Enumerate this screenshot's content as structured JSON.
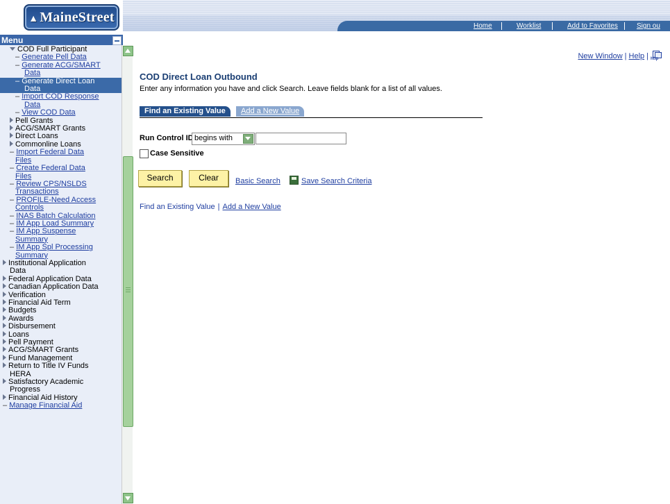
{
  "logo": {
    "text": "MaineStreet"
  },
  "nav": {
    "home": "Home",
    "worklist": "Worklist",
    "favorites": "Add to Favorites",
    "signout": "Sign ou"
  },
  "menu": {
    "title": "Menu",
    "items": [
      {
        "label": "COD Full Participant",
        "type": "folder-open",
        "indent": 1
      },
      {
        "label": "Generate Pell Data",
        "type": "link",
        "indent": 2
      },
      {
        "label": "Generate ACG/SMART",
        "type": "link",
        "indent": 2
      },
      {
        "label": "Data",
        "type": "link-cont",
        "indent": 3
      },
      {
        "label": "Generate Direct Loan",
        "type": "link",
        "indent": 2,
        "selected": true
      },
      {
        "label": "Data",
        "type": "link-cont",
        "indent": 3,
        "selected": true
      },
      {
        "label": "Import COD Response",
        "type": "link",
        "indent": 2
      },
      {
        "label": "Data",
        "type": "link-cont",
        "indent": 3
      },
      {
        "label": "View COD Data",
        "type": "link",
        "indent": 2
      },
      {
        "label": "Pell Grants",
        "type": "folder",
        "indent": 1
      },
      {
        "label": "ACG/SMART Grants",
        "type": "folder",
        "indent": 1
      },
      {
        "label": "Direct Loans",
        "type": "folder",
        "indent": 1
      },
      {
        "label": "Commonline Loans",
        "type": "folder",
        "indent": 1
      },
      {
        "label": "Import Federal Data",
        "type": "link",
        "indent": 1
      },
      {
        "label": "Files",
        "type": "link-cont",
        "indent": 2
      },
      {
        "label": "Create Federal Data",
        "type": "link",
        "indent": 1
      },
      {
        "label": "Files",
        "type": "link-cont",
        "indent": 2
      },
      {
        "label": "Review CPS/NSLDS",
        "type": "link",
        "indent": 1
      },
      {
        "label": "Transactions",
        "type": "link-cont",
        "indent": 2
      },
      {
        "label": "PROFILE-Need Access",
        "type": "link",
        "indent": 1
      },
      {
        "label": "Controls",
        "type": "link-cont",
        "indent": 2
      },
      {
        "label": "INAS Batch Calculation",
        "type": "link",
        "indent": 1
      },
      {
        "label": "IM App Load Summary",
        "type": "link",
        "indent": 1
      },
      {
        "label": "IM App Suspense",
        "type": "link",
        "indent": 1
      },
      {
        "label": "Summary",
        "type": "link-cont",
        "indent": 2
      },
      {
        "label": "IM App Spl Processing",
        "type": "link",
        "indent": 1
      },
      {
        "label": "Summary",
        "type": "link-cont",
        "indent": 2
      },
      {
        "label": "Institutional Application",
        "type": "folder",
        "indent": 0
      },
      {
        "label": "Data",
        "type": "text-cont",
        "indent": 1
      },
      {
        "label": "Federal Application Data",
        "type": "folder",
        "indent": 0
      },
      {
        "label": "Canadian Application Data",
        "type": "folder",
        "indent": 0
      },
      {
        "label": "Verification",
        "type": "folder",
        "indent": 0
      },
      {
        "label": "Financial Aid Term",
        "type": "folder",
        "indent": 0
      },
      {
        "label": "Budgets",
        "type": "folder",
        "indent": 0
      },
      {
        "label": "Awards",
        "type": "folder",
        "indent": 0
      },
      {
        "label": "Disbursement",
        "type": "folder",
        "indent": 0
      },
      {
        "label": "Loans",
        "type": "folder",
        "indent": 0
      },
      {
        "label": "Pell Payment",
        "type": "folder",
        "indent": 0
      },
      {
        "label": "ACG/SMART Grants",
        "type": "folder",
        "indent": 0
      },
      {
        "label": "Fund Management",
        "type": "folder",
        "indent": 0
      },
      {
        "label": "Return to Title IV Funds",
        "type": "folder",
        "indent": 0
      },
      {
        "label": "HERA",
        "type": "text-cont",
        "indent": 1
      },
      {
        "label": "Satisfactory Academic",
        "type": "folder",
        "indent": 0
      },
      {
        "label": "Progress",
        "type": "text-cont",
        "indent": 1
      },
      {
        "label": "Financial Aid History",
        "type": "folder",
        "indent": 0
      },
      {
        "label": "Manage Financial Aid",
        "type": "link",
        "indent": 0
      }
    ]
  },
  "util": {
    "new_window": "New Window",
    "help": "Help",
    "sep": "|",
    "http_icon": "http"
  },
  "page": {
    "title": "COD Direct Loan Outbound",
    "instructions": "Enter any information you have and click Search. Leave fields blank for a list of all values.",
    "tab_active": "Find an Existing Value",
    "tab_inactive": "Add a New Value",
    "run_control_label": "Run Control ID:",
    "operator": "begins with",
    "run_control_value": "",
    "case_sensitive": "Case Sensitive",
    "search_btn": "Search",
    "clear_btn": "Clear",
    "basic_search": "Basic Search",
    "save_criteria": "Save Search Criteria",
    "bottom_current": "Find an Existing Value",
    "bottom_sep": "|",
    "bottom_add": "Add a New Value"
  },
  "colors": {
    "menu_bg": "#e9eef8",
    "selected_bg": "#3b6aa8",
    "link": "#1f3ea0",
    "title": "#1a3e73",
    "button": "#fdf2a6",
    "scrollbar": "#a5d19c"
  }
}
